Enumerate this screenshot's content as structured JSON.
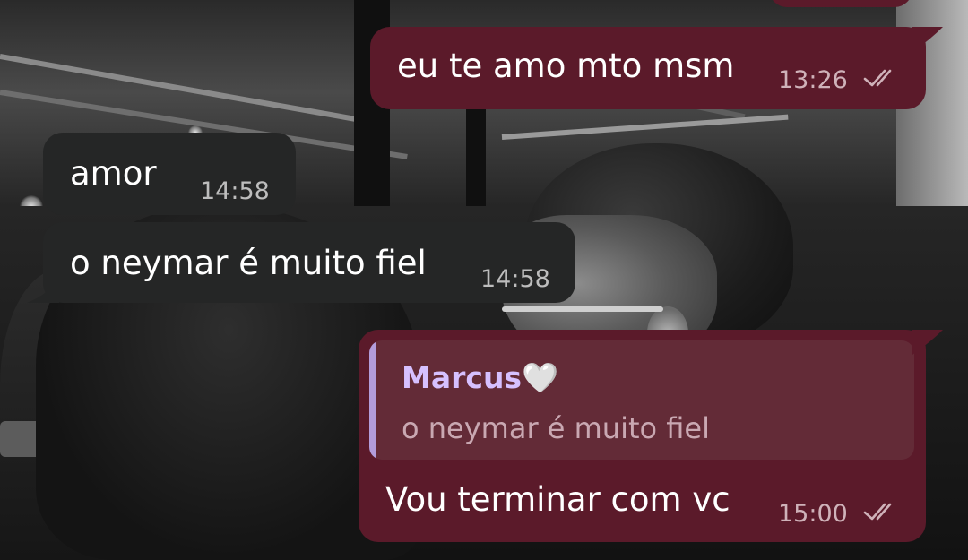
{
  "messages": [
    {
      "id": "m0",
      "direction": "outgoing",
      "text": "",
      "partially_visible": true
    },
    {
      "id": "m1",
      "direction": "outgoing",
      "text": "eu te amo mto msm",
      "time": "13:26",
      "status": "read"
    },
    {
      "id": "m2",
      "direction": "incoming",
      "text": "amor",
      "time": "14:58"
    },
    {
      "id": "m3",
      "direction": "incoming",
      "text": "o neymar é muito fiel",
      "time": "14:58"
    },
    {
      "id": "m4",
      "direction": "outgoing",
      "reply": {
        "author": "Marcus",
        "author_emoji": "🤍",
        "text": "o neymar é muito fiel"
      },
      "text": "Vou terminar com vc",
      "time": "15:00",
      "status": "read"
    }
  ],
  "colors": {
    "outgoing_bubble": "#5b1a2a",
    "incoming_bubble": "#252626",
    "reply_box": "#632b37",
    "reply_accent": "#b39ddb",
    "reply_author": "#d6c0ff"
  },
  "icons": {
    "read_receipt": "double-check-icon"
  }
}
